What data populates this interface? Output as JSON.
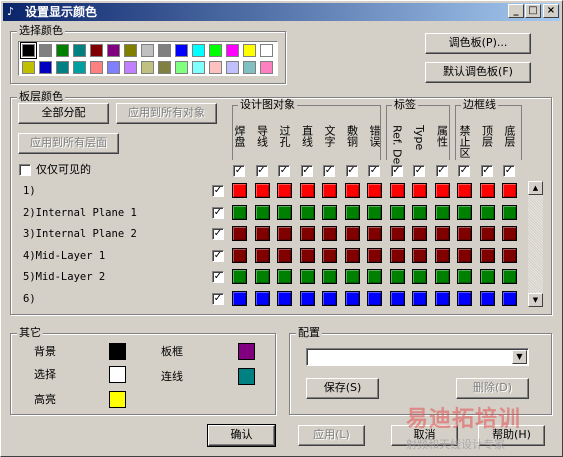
{
  "window": {
    "title": "设置显示颜色",
    "minimize": "_",
    "maximize": "□",
    "close": "×",
    "colors": {
      "title_start": "#0a246a",
      "title_end": "#a6caf0"
    }
  },
  "palette": {
    "group_label": "选择颜色",
    "colors": [
      "#000000",
      "#808080",
      "#008000",
      "#008080",
      "#800000",
      "#800080",
      "#808000",
      "#c0c0c0",
      "#808080",
      "#0000ff",
      "#00ffff",
      "#00ff00",
      "#ff00ff",
      "#ffff00",
      "#ffffff",
      "#c0c000",
      "#0000c0",
      "#008080",
      "#00a0a0",
      "#ff8080",
      "#8080ff",
      "#c080ff",
      "#c0c080",
      "#808040",
      "#80ff80",
      "#80ffff",
      "#ffc0c0",
      "#c0c0ff",
      "#80c0c0",
      "#ff80c0"
    ],
    "button_palette": "调色板(P)...",
    "button_default": "默认调色板(F)"
  },
  "layer_colors": {
    "group_label": "板层颜色",
    "btn_all": "全部分配",
    "btn_apply_objects": "应用到所有对象",
    "btn_apply_layers": "应用到所有层面",
    "visible_only": "仅仅可见的",
    "cat_design": "设计图对象",
    "cat_label": "标签",
    "cat_outline": "边框线",
    "columns": [
      "焊盘",
      "导线",
      "过孔",
      "直线",
      "文字",
      "敷铜",
      "错误",
      "Ref. Des",
      "Type",
      "属性",
      "禁止区",
      "顶层",
      "底层"
    ],
    "rows": [
      {
        "label": "1)",
        "colors": [
          "#ff0000",
          "#ff0000",
          "#ff0000",
          "#ff0000",
          "#ff0000",
          "#ff0000",
          "#ff0000",
          "#ff0000",
          "#ff0000",
          "#ff0000",
          "#ff0000",
          "#ff0000",
          "#ff0000"
        ]
      },
      {
        "label": "2)Internal Plane 1",
        "colors": [
          "#008000",
          "#008000",
          "#008000",
          "#008000",
          "#008000",
          "#008000",
          "#008000",
          "#008000",
          "#008000",
          "#008000",
          "#008000",
          "#008000",
          "#008000"
        ]
      },
      {
        "label": "3)Internal Plane 2",
        "colors": [
          "#800000",
          "#800000",
          "#800000",
          "#800000",
          "#800000",
          "#800000",
          "#800000",
          "#800000",
          "#800000",
          "#800000",
          "#800000",
          "#800000",
          "#800000"
        ]
      },
      {
        "label": "4)Mid-Layer 1",
        "colors": [
          "#800000",
          "#800000",
          "#800000",
          "#800000",
          "#800000",
          "#800000",
          "#800000",
          "#800000",
          "#800000",
          "#800000",
          "#800000",
          "#800000",
          "#800000"
        ]
      },
      {
        "label": "5)Mid-Layer 2",
        "colors": [
          "#008000",
          "#008000",
          "#008000",
          "#008000",
          "#008000",
          "#008000",
          "#008000",
          "#008000",
          "#008000",
          "#008000",
          "#008000",
          "#008000",
          "#008000"
        ]
      },
      {
        "label": "6)",
        "colors": [
          "#0000ff",
          "#0000ff",
          "#0000ff",
          "#0000ff",
          "#0000ff",
          "#0000ff",
          "#0000ff",
          "#0000ff",
          "#0000ff",
          "#0000ff",
          "#0000ff",
          "#0000ff",
          "#0000ff"
        ]
      }
    ],
    "check_mark": "✓"
  },
  "other": {
    "group_label": "其它",
    "background": "背景",
    "background_color": "#000000",
    "selection": "选择",
    "selection_color": "#ffffff",
    "highlight": "高亮",
    "highlight_color": "#ffff00",
    "board_frame": "板框",
    "board_frame_color": "#800080",
    "connection": "连线",
    "connection_color": "#008080"
  },
  "config": {
    "group_label": "配置",
    "combo_value": "",
    "btn_save": "保存(S)",
    "btn_delete": "删除(D)"
  },
  "footer": {
    "ok": "确认",
    "apply": "应用(L)",
    "cancel": "取消",
    "help": "帮助(H)"
  },
  "watermark": {
    "main": "易迪拓培训",
    "sub": "射频和天线设计专家"
  }
}
